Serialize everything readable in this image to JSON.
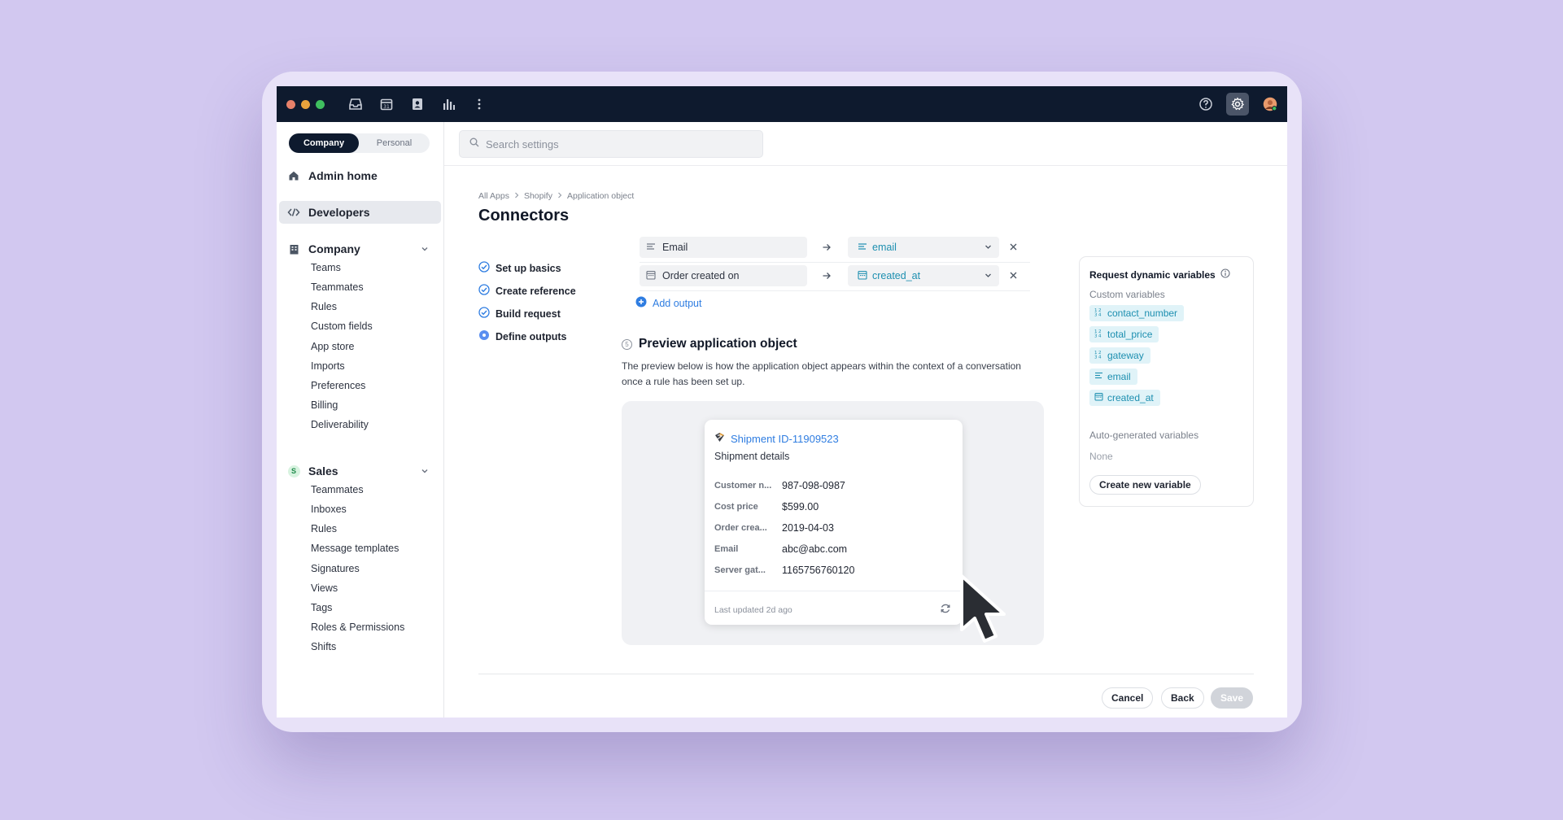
{
  "segment": {
    "company": "Company",
    "personal": "Personal"
  },
  "nav": {
    "admin_home": "Admin home",
    "developers": "Developers",
    "company": {
      "title": "Company",
      "items": [
        "Teams",
        "Teammates",
        "Rules",
        "Custom fields",
        "App store",
        "Imports",
        "Preferences",
        "Billing",
        "Deliverability"
      ]
    },
    "sales": {
      "badge": "S",
      "title": "Sales",
      "items": [
        "Teammates",
        "Inboxes",
        "Rules",
        "Message templates",
        "Signatures",
        "Views",
        "Tags",
        "Roles & Permissions",
        "Shifts"
      ]
    }
  },
  "search": {
    "placeholder": "Search settings"
  },
  "breadcrumb": [
    "All Apps",
    "Shopify",
    "Application object"
  ],
  "page_title": "Connectors",
  "steps": [
    "Set up basics",
    "Create reference",
    "Build request",
    "Define outputs"
  ],
  "mappings": [
    {
      "source": "Email",
      "target": "email"
    },
    {
      "source": "Order created on",
      "target": "created_at"
    }
  ],
  "add_output": "Add output",
  "preview": {
    "step_number": "5",
    "title": "Preview application object",
    "description": "The preview below is how the application object appears within the context of a conversation once a rule has been set up.",
    "card": {
      "link": "Shipment ID-11909523",
      "subtitle": "Shipment details",
      "fields": [
        {
          "key": "Customer n...",
          "value": "987-098-0987"
        },
        {
          "key": "Cost price",
          "value": "$599.00"
        },
        {
          "key": "Order crea...",
          "value": "2019-04-03"
        },
        {
          "key": "Email",
          "value": "abc@abc.com"
        },
        {
          "key": "Server gat...",
          "value": "1165756760120"
        }
      ],
      "updated": "Last updated 2d ago"
    }
  },
  "variables": {
    "title": "Request dynamic variables",
    "custom_label": "Custom variables",
    "custom": [
      "contact_number",
      "total_price",
      "gateway",
      "email",
      "created_at"
    ],
    "auto_label": "Auto-generated variables",
    "auto_none": "None",
    "create_button": "Create new variable"
  },
  "footer": {
    "cancel": "Cancel",
    "back": "Back",
    "save": "Save"
  },
  "colors": {
    "titlebar": "#0e1a2e",
    "accent_blue": "#2f7de1",
    "variable_teal": "#1d8fb0",
    "dot_red": "#e7816a",
    "dot_yellow": "#e8a33c",
    "dot_green": "#3fbf5f"
  }
}
